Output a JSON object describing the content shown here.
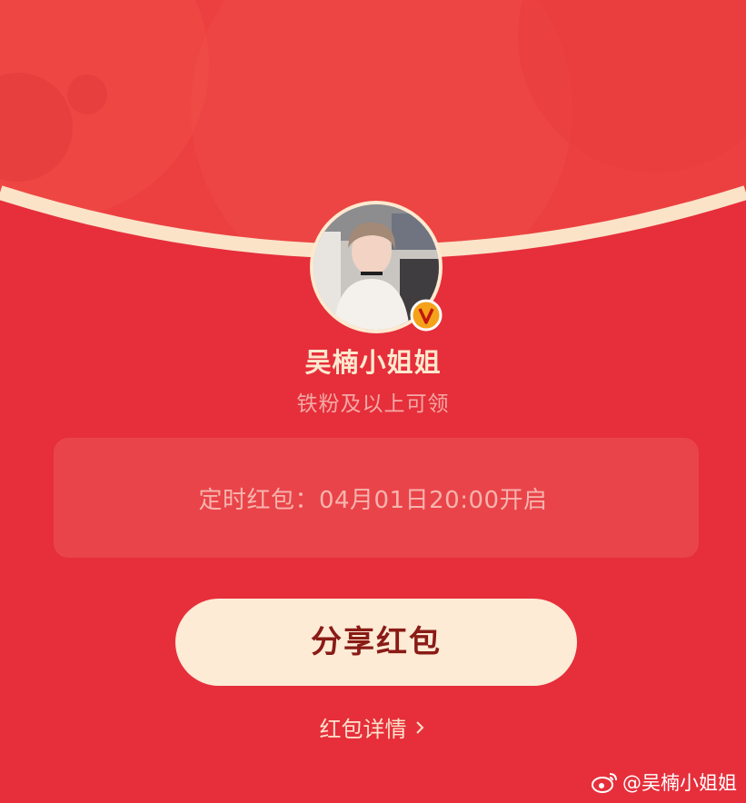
{
  "colors": {
    "background": "#e62f3b",
    "header": "#ec4040",
    "arc_border": "#fbe3c8",
    "name_text": "#fde9cf",
    "button_bg": "#fdebd6",
    "button_text": "#8a1b16"
  },
  "profile": {
    "name": "吴楠小姐姐",
    "eligibility": "铁粉及以上可领",
    "verified_icon": "verified-v-badge-icon",
    "avatar": "user-avatar-photo"
  },
  "packet": {
    "timed_text": "定时红包：04月01日20:00开启"
  },
  "actions": {
    "share_label": "分享红包",
    "details_label": "红包详情",
    "details_icon": "chevron-right-icon"
  },
  "watermark": {
    "text": "@吴楠小姐姐",
    "icon": "weibo-logo-icon"
  }
}
